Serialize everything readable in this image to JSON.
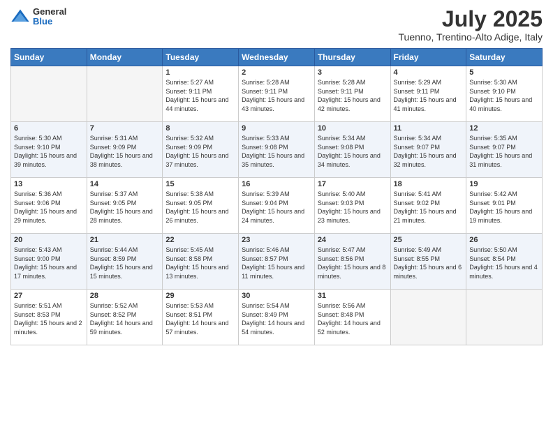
{
  "header": {
    "logo": {
      "general": "General",
      "blue": "Blue"
    },
    "title": "July 2025",
    "subtitle": "Tuenno, Trentino-Alto Adige, Italy"
  },
  "calendar": {
    "weekdays": [
      "Sunday",
      "Monday",
      "Tuesday",
      "Wednesday",
      "Thursday",
      "Friday",
      "Saturday"
    ],
    "weeks": [
      [
        {
          "day": null
        },
        {
          "day": null
        },
        {
          "day": "1",
          "sunrise": "Sunrise: 5:27 AM",
          "sunset": "Sunset: 9:11 PM",
          "daylight": "Daylight: 15 hours and 44 minutes."
        },
        {
          "day": "2",
          "sunrise": "Sunrise: 5:28 AM",
          "sunset": "Sunset: 9:11 PM",
          "daylight": "Daylight: 15 hours and 43 minutes."
        },
        {
          "day": "3",
          "sunrise": "Sunrise: 5:28 AM",
          "sunset": "Sunset: 9:11 PM",
          "daylight": "Daylight: 15 hours and 42 minutes."
        },
        {
          "day": "4",
          "sunrise": "Sunrise: 5:29 AM",
          "sunset": "Sunset: 9:11 PM",
          "daylight": "Daylight: 15 hours and 41 minutes."
        },
        {
          "day": "5",
          "sunrise": "Sunrise: 5:30 AM",
          "sunset": "Sunset: 9:10 PM",
          "daylight": "Daylight: 15 hours and 40 minutes."
        }
      ],
      [
        {
          "day": "6",
          "sunrise": "Sunrise: 5:30 AM",
          "sunset": "Sunset: 9:10 PM",
          "daylight": "Daylight: 15 hours and 39 minutes."
        },
        {
          "day": "7",
          "sunrise": "Sunrise: 5:31 AM",
          "sunset": "Sunset: 9:09 PM",
          "daylight": "Daylight: 15 hours and 38 minutes."
        },
        {
          "day": "8",
          "sunrise": "Sunrise: 5:32 AM",
          "sunset": "Sunset: 9:09 PM",
          "daylight": "Daylight: 15 hours and 37 minutes."
        },
        {
          "day": "9",
          "sunrise": "Sunrise: 5:33 AM",
          "sunset": "Sunset: 9:08 PM",
          "daylight": "Daylight: 15 hours and 35 minutes."
        },
        {
          "day": "10",
          "sunrise": "Sunrise: 5:34 AM",
          "sunset": "Sunset: 9:08 PM",
          "daylight": "Daylight: 15 hours and 34 minutes."
        },
        {
          "day": "11",
          "sunrise": "Sunrise: 5:34 AM",
          "sunset": "Sunset: 9:07 PM",
          "daylight": "Daylight: 15 hours and 32 minutes."
        },
        {
          "day": "12",
          "sunrise": "Sunrise: 5:35 AM",
          "sunset": "Sunset: 9:07 PM",
          "daylight": "Daylight: 15 hours and 31 minutes."
        }
      ],
      [
        {
          "day": "13",
          "sunrise": "Sunrise: 5:36 AM",
          "sunset": "Sunset: 9:06 PM",
          "daylight": "Daylight: 15 hours and 29 minutes."
        },
        {
          "day": "14",
          "sunrise": "Sunrise: 5:37 AM",
          "sunset": "Sunset: 9:05 PM",
          "daylight": "Daylight: 15 hours and 28 minutes."
        },
        {
          "day": "15",
          "sunrise": "Sunrise: 5:38 AM",
          "sunset": "Sunset: 9:05 PM",
          "daylight": "Daylight: 15 hours and 26 minutes."
        },
        {
          "day": "16",
          "sunrise": "Sunrise: 5:39 AM",
          "sunset": "Sunset: 9:04 PM",
          "daylight": "Daylight: 15 hours and 24 minutes."
        },
        {
          "day": "17",
          "sunrise": "Sunrise: 5:40 AM",
          "sunset": "Sunset: 9:03 PM",
          "daylight": "Daylight: 15 hours and 23 minutes."
        },
        {
          "day": "18",
          "sunrise": "Sunrise: 5:41 AM",
          "sunset": "Sunset: 9:02 PM",
          "daylight": "Daylight: 15 hours and 21 minutes."
        },
        {
          "day": "19",
          "sunrise": "Sunrise: 5:42 AM",
          "sunset": "Sunset: 9:01 PM",
          "daylight": "Daylight: 15 hours and 19 minutes."
        }
      ],
      [
        {
          "day": "20",
          "sunrise": "Sunrise: 5:43 AM",
          "sunset": "Sunset: 9:00 PM",
          "daylight": "Daylight: 15 hours and 17 minutes."
        },
        {
          "day": "21",
          "sunrise": "Sunrise: 5:44 AM",
          "sunset": "Sunset: 8:59 PM",
          "daylight": "Daylight: 15 hours and 15 minutes."
        },
        {
          "day": "22",
          "sunrise": "Sunrise: 5:45 AM",
          "sunset": "Sunset: 8:58 PM",
          "daylight": "Daylight: 15 hours and 13 minutes."
        },
        {
          "day": "23",
          "sunrise": "Sunrise: 5:46 AM",
          "sunset": "Sunset: 8:57 PM",
          "daylight": "Daylight: 15 hours and 11 minutes."
        },
        {
          "day": "24",
          "sunrise": "Sunrise: 5:47 AM",
          "sunset": "Sunset: 8:56 PM",
          "daylight": "Daylight: 15 hours and 8 minutes."
        },
        {
          "day": "25",
          "sunrise": "Sunrise: 5:49 AM",
          "sunset": "Sunset: 8:55 PM",
          "daylight": "Daylight: 15 hours and 6 minutes."
        },
        {
          "day": "26",
          "sunrise": "Sunrise: 5:50 AM",
          "sunset": "Sunset: 8:54 PM",
          "daylight": "Daylight: 15 hours and 4 minutes."
        }
      ],
      [
        {
          "day": "27",
          "sunrise": "Sunrise: 5:51 AM",
          "sunset": "Sunset: 8:53 PM",
          "daylight": "Daylight: 15 hours and 2 minutes."
        },
        {
          "day": "28",
          "sunrise": "Sunrise: 5:52 AM",
          "sunset": "Sunset: 8:52 PM",
          "daylight": "Daylight: 14 hours and 59 minutes."
        },
        {
          "day": "29",
          "sunrise": "Sunrise: 5:53 AM",
          "sunset": "Sunset: 8:51 PM",
          "daylight": "Daylight: 14 hours and 57 minutes."
        },
        {
          "day": "30",
          "sunrise": "Sunrise: 5:54 AM",
          "sunset": "Sunset: 8:49 PM",
          "daylight": "Daylight: 14 hours and 54 minutes."
        },
        {
          "day": "31",
          "sunrise": "Sunrise: 5:56 AM",
          "sunset": "Sunset: 8:48 PM",
          "daylight": "Daylight: 14 hours and 52 minutes."
        },
        {
          "day": null
        },
        {
          "day": null
        }
      ]
    ]
  }
}
